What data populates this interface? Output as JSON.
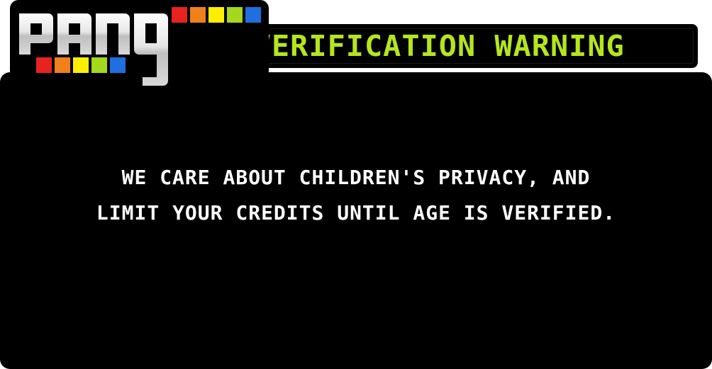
{
  "logo": {
    "text": "PANG",
    "palette": [
      "#e8231f",
      "#f0801a",
      "#ffee00",
      "#a4d81c",
      "#1f6fe0"
    ]
  },
  "header": {
    "title": "AGE VERIFICATION WARNING",
    "title_color": "#b5e61d"
  },
  "message": {
    "line1": "WE CARE ABOUT CHILDREN'S PRIVACY, AND",
    "line2": "LIMIT YOUR CREDITS UNTIL AGE IS VERIFIED."
  },
  "colors": {
    "panel": "#000000",
    "text": "#ffffff"
  }
}
